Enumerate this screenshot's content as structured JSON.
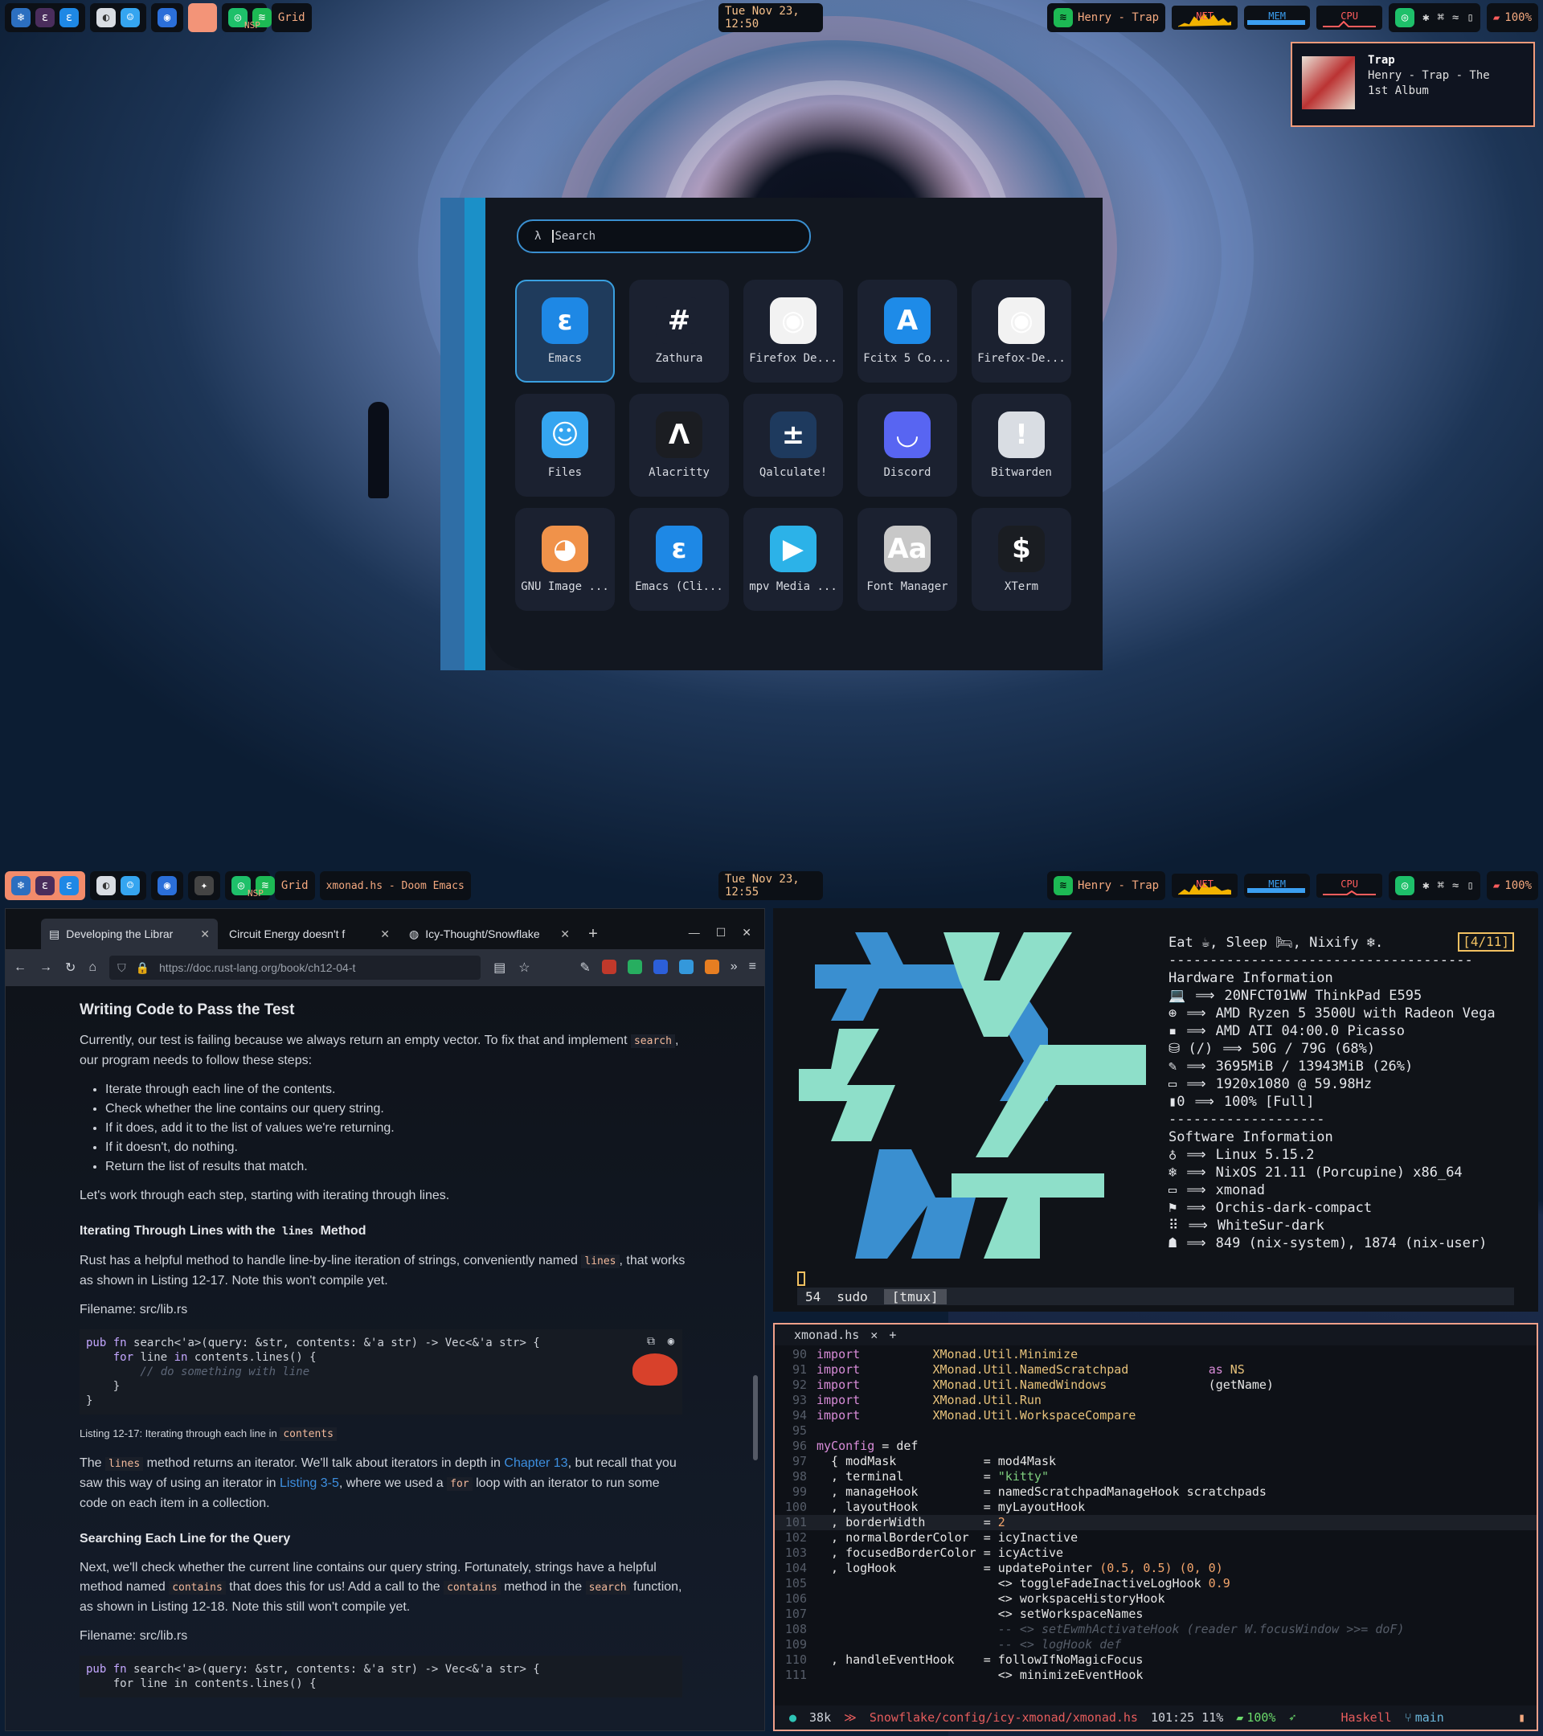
{
  "top_bar": {
    "nsp": "NSP",
    "grid": "Grid",
    "clock": "Tue Nov 23, 12:50",
    "spotify": "Henry - Trap",
    "net": "NET",
    "mem": "MEM",
    "cpu": "CPU",
    "battery": "100%",
    "mem_fraction": 0.88
  },
  "notification": {
    "title": "Trap",
    "body": "Henry - Trap - The 1st Album"
  },
  "launcher": {
    "prompt_glyph": "λ",
    "placeholder": "Search",
    "apps": [
      {
        "label": "Emacs",
        "icon": "emacs-icon",
        "glyph": "ε",
        "color": "#1e88e5",
        "selected": true
      },
      {
        "label": "Zathura",
        "icon": "zathura-icon",
        "glyph": "#",
        "color": "#1b2130",
        "selected": false
      },
      {
        "label": "Firefox De...",
        "icon": "firefox-dev-icon",
        "glyph": "◉",
        "color": "#f2f2f2",
        "selected": false
      },
      {
        "label": "Fcitx 5 Co...",
        "icon": "fcitx-icon",
        "glyph": "A",
        "color": "#1e8be8",
        "selected": false
      },
      {
        "label": "Firefox-De...",
        "icon": "firefox-dev-icon",
        "glyph": "◉",
        "color": "#f2f2f2",
        "selected": false
      },
      {
        "label": "Files",
        "icon": "files-icon",
        "glyph": "☺",
        "color": "#35a5f0",
        "selected": false
      },
      {
        "label": "Alacritty",
        "icon": "alacritty-icon",
        "glyph": "Λ",
        "color": "#1b1d22",
        "selected": false
      },
      {
        "label": "Qalculate!",
        "icon": "calculator-icon",
        "glyph": "±",
        "color": "#1e3a5e",
        "selected": false
      },
      {
        "label": "Discord",
        "icon": "discord-icon",
        "glyph": "◡",
        "color": "#5865f2",
        "selected": false
      },
      {
        "label": "Bitwarden",
        "icon": "bitwarden-icon",
        "glyph": "!",
        "color": "#d9dde3",
        "selected": false
      },
      {
        "label": "GNU Image ...",
        "icon": "gimp-icon",
        "glyph": "◕",
        "color": "#f0924a",
        "selected": false
      },
      {
        "label": "Emacs (Cli...",
        "icon": "emacs-icon",
        "glyph": "ε",
        "color": "#1e88e5",
        "selected": false
      },
      {
        "label": "mpv Media ...",
        "icon": "mpv-icon",
        "glyph": "▶",
        "color": "#2cb2e8",
        "selected": false
      },
      {
        "label": "Font Manager",
        "icon": "font-manager-icon",
        "glyph": "Aa",
        "color": "#c8c8c8",
        "selected": false
      },
      {
        "label": "XTerm",
        "icon": "xterm-icon",
        "glyph": "$",
        "color": "#1a1d22",
        "selected": false
      }
    ]
  },
  "bottom_bar": {
    "nsp": "NSP",
    "grid": "Grid",
    "title": "xmonad.hs - Doom Emacs",
    "clock": "Tue Nov 23, 12:55",
    "spotify": "Henry - Trap",
    "net": "NET",
    "mem": "MEM",
    "cpu": "CPU",
    "battery": "100%",
    "mem_fraction": 0.88
  },
  "browser": {
    "tabs": [
      {
        "label": "Developing the Librar"
      },
      {
        "label": "Circuit Energy doesn't f"
      },
      {
        "label": "Icy-Thought/Snowflake"
      }
    ],
    "url": "https://doc.rust-lang.org/book/ch12-04-t",
    "doc": {
      "h_write": "Writing Code to Pass the Test",
      "p1a": "Currently, our test is failing because we always return an empty vector. To fix that and implement",
      "p1code": "search",
      "p1b": ", our program needs to follow these steps:",
      "steps": [
        "Iterate through each line of the contents.",
        "Check whether the line contains our query string.",
        "If it does, add it to the list of values we're returning.",
        "If it doesn't, do nothing.",
        "Return the list of results that match."
      ],
      "p2": "Let's work through each step, starting with iterating through lines.",
      "h_iter_a": "Iterating Through Lines with the ",
      "h_iter_code": "lines",
      "h_iter_b": " Method",
      "p3a": "Rust has a helpful method to handle line-by-line iteration of strings, conveniently named",
      "p3code": "lines",
      "p3b": ", that works as shown in Listing 12-17. Note this won't compile yet.",
      "filename": "Filename: src/lib.rs",
      "code1": {
        "l1a": "pub fn ",
        "l1b": "search<'a>(query: &str, contents: &'a str) -> Vec<&'a str> {",
        "l2a": "    for ",
        "l2b": "line ",
        "l2c": "in ",
        "l2d": "contents.lines() {",
        "l3": "        // do something with line",
        "l4": "    }",
        "l5": "}"
      },
      "caption_a": "Listing 12-17: Iterating through each line in ",
      "caption_code": "contents",
      "p4a": "The",
      "p4code": "lines",
      "p4b": "method returns an iterator. We'll talk about iterators in depth in",
      "p4link": "Chapter 13",
      "p4c": ", but recall that you saw this way of using an iterator in",
      "p4link2": "Listing 3-5",
      "p4d": ", where we used a",
      "p4code2": "for",
      "p4e": "loop with an iterator to run some code on each item in a collection.",
      "h_search": "Searching Each Line for the Query",
      "p5a": "Next, we'll check whether the current line contains our query string. Fortunately, strings have a helpful method named",
      "p5code": "contains",
      "p5b": "that does this for us! Add a call to the",
      "p5code2": "contains",
      "p5c": "method in the",
      "p5code3": "search",
      "p5d": "function, as shown in Listing 12-18. Note this still won't compile yet.",
      "filename2": "Filename: src/lib.rs",
      "code2": {
        "l1a": "pub fn ",
        "l1b": "search<'a>(query: &str, contents: &'a str) -> Vec<&'a str> {",
        "l2": "    for line in contents.lines() {"
      }
    }
  },
  "terminal": {
    "header": "Eat ☕, Sleep 🛏, Nixify ❄.",
    "page": "[4/11]",
    "rule": "-------------------------------------",
    "hw_title": "Hardware Information",
    "hw": [
      "20NFCT01WW ThinkPad E595",
      "AMD Ryzen 5 3500U with Radeon Vega",
      "AMD ATI 04:00.0 Picasso",
      "50G / 79G (68%)",
      "3695MiB / 13943MiB (26%)",
      "1920x1080 @ 59.98Hz",
      "100% [Full]"
    ],
    "hw_icons": [
      "💻",
      "⊕",
      "▪",
      "⛁ (/)",
      "✎",
      "▭",
      "▮0"
    ],
    "rule2": "-------------------",
    "sw_title": "Software Information",
    "sw": [
      "Linux 5.15.2",
      "NixOS 21.11 (Porcupine) x86_64",
      "xmonad",
      "Orchis-dark-compact",
      "WhiteSur-dark",
      "849 (nix-system), 1874 (nix-user)"
    ],
    "sw_icons": [
      "♁",
      "❄",
      "▭",
      "⚑",
      "⠿",
      "☗"
    ],
    "arrow": "⟹",
    "tmux": {
      "num": "54",
      "cmd": "sudo",
      "session": "[tmux]"
    }
  },
  "emacs": {
    "file_tab": "xmonad.hs",
    "lines": [
      {
        "n": "90",
        "t": [
          [
            "ekw",
            "import"
          ],
          [
            "",
            "          "
          ],
          [
            "emod",
            "XMonad.Util.Minimize"
          ]
        ]
      },
      {
        "n": "91",
        "t": [
          [
            "ekw",
            "import"
          ],
          [
            "",
            "          "
          ],
          [
            "emod",
            "XMonad.Util.NamedScratchpad"
          ],
          [
            "",
            "           "
          ],
          [
            "ekw",
            "as"
          ],
          [
            "emod",
            " NS"
          ]
        ]
      },
      {
        "n": "92",
        "t": [
          [
            "ekw",
            "import"
          ],
          [
            "",
            "          "
          ],
          [
            "emod",
            "XMonad.Util.NamedWindows"
          ],
          [
            "",
            "              (getName)"
          ]
        ]
      },
      {
        "n": "93",
        "t": [
          [
            "ekw",
            "import"
          ],
          [
            "",
            "          "
          ],
          [
            "emod",
            "XMonad.Util.Run"
          ]
        ]
      },
      {
        "n": "94",
        "t": [
          [
            "ekw",
            "import"
          ],
          [
            "",
            "          "
          ],
          [
            "emod",
            "XMonad.Util.WorkspaceCompare"
          ]
        ]
      },
      {
        "n": "95",
        "t": []
      },
      {
        "n": "96",
        "t": [
          [
            "ekw",
            "myConfig"
          ],
          [
            "",
            " = def"
          ]
        ]
      },
      {
        "n": "97",
        "t": [
          [
            "",
            "  { modMask            = mod4Mask"
          ]
        ]
      },
      {
        "n": "98",
        "t": [
          [
            "",
            "  , terminal           = "
          ],
          [
            "estr",
            "\"kitty\""
          ]
        ]
      },
      {
        "n": "99",
        "t": [
          [
            "",
            "  , manageHook         = namedScratchpadManageHook scratchpads"
          ]
        ]
      },
      {
        "n": "100",
        "t": [
          [
            "",
            "  , layoutHook         = myLayoutHook"
          ]
        ]
      },
      {
        "n": "101",
        "t": [
          [
            "",
            "  , borderWidth        = "
          ],
          [
            "enum",
            "2"
          ]
        ],
        "hl": true
      },
      {
        "n": "102",
        "t": [
          [
            "",
            "  , normalBorderColor  = icyInactive"
          ]
        ]
      },
      {
        "n": "103",
        "t": [
          [
            "",
            "  , focusedBorderColor = icyActive"
          ]
        ]
      },
      {
        "n": "104",
        "t": [
          [
            "",
            "  , logHook            = updatePointer "
          ],
          [
            "enum",
            "(0.5, 0.5) (0, 0)"
          ]
        ]
      },
      {
        "n": "105",
        "t": [
          [
            "",
            "                         <> toggleFadeInactiveLogHook "
          ],
          [
            "enum",
            "0.9"
          ]
        ]
      },
      {
        "n": "106",
        "t": [
          [
            "",
            "                         <> workspaceHistoryHook"
          ]
        ]
      },
      {
        "n": "107",
        "t": [
          [
            "",
            "                         <> setWorkspaceNames"
          ]
        ]
      },
      {
        "n": "108",
        "t": [
          [
            "ecm",
            "                         -- <> setEwmhActivateHook (reader W.focusWindow >>= doF)"
          ]
        ]
      },
      {
        "n": "109",
        "t": [
          [
            "ecm",
            "                         -- <> logHook def"
          ]
        ]
      },
      {
        "n": "110",
        "t": [
          [
            "",
            "  , handleEventHook    = followIfNoMagicFocus"
          ]
        ]
      },
      {
        "n": "111",
        "t": [
          [
            "",
            "                         <> minimizeEventHook"
          ]
        ]
      }
    ],
    "modeline": {
      "size": "38k",
      "path": "Snowflake/config/icy-xmonad/xmonad.hs",
      "pos": "101:25 11%",
      "battery": "100%",
      "mode": "Haskell",
      "branch": "main"
    }
  }
}
